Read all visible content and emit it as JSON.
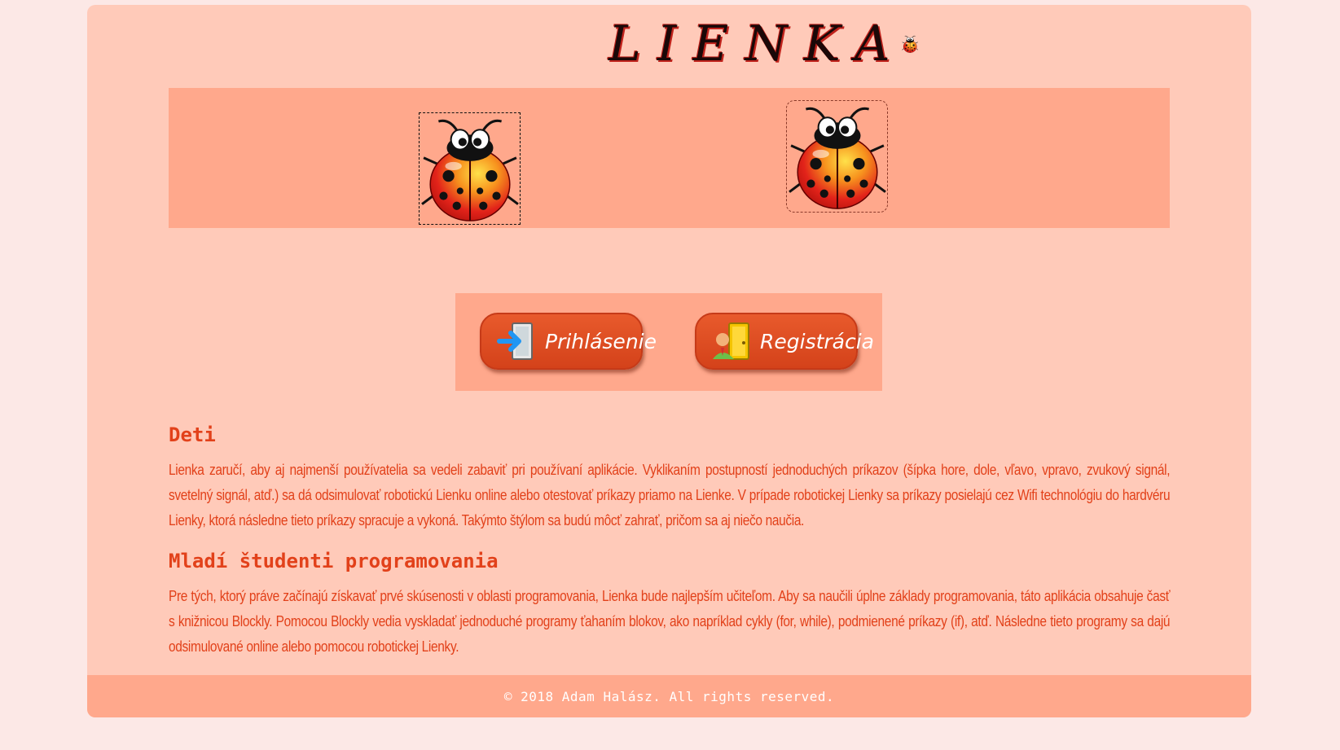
{
  "colors": {
    "page_bg": "#fce8e6",
    "card_bg": "#ffcab9",
    "accent_panel": "#ffa88c",
    "text_accent": "#e2411a",
    "button_bg": "#e04e22"
  },
  "header": {
    "logo_text": "LIENKA",
    "logo_icon": "ladybug-icon"
  },
  "banner": {
    "images": [
      {
        "icon": "ladybug-icon"
      },
      {
        "icon": "ladybug-icon"
      }
    ]
  },
  "buttons": {
    "login_label": "Prihlásenie",
    "login_icon": "door-enter-icon",
    "register_label": "Registrácia",
    "register_icon": "user-door-icon"
  },
  "sections": [
    {
      "heading": "Deti",
      "text": "Lienka zaručí, aby aj najmenší používatelia sa vedeli zabaviť pri používaní aplikácie. Vyklikaním postupností jednoduchých príkazov (šípka hore, dole, vľavo, vpravo, zvukový signál, svetelný signál, atď.) sa dá odsimulovať robotickú Lienku online alebo otestovať príkazy priamo na Lienke. V prípade robotickej Lienky sa príkazy posielajú cez Wifi technológiu do hardvéru Lienky, ktorá následne tieto príkazy spracuje a vykoná. Takýmto štýlom sa budú môcť zahrať, pričom sa aj niečo naučia."
    },
    {
      "heading": "Mladí študenti programovania",
      "text": "Pre tých, ktorý práve začínajú získavať prvé skúsenosti v oblasti programovania, Lienka bude najlepším učiteľom. Aby sa naučili úplne základy programovania, táto aplikácia obsahuje časť s knižnicou Blockly. Pomocou Blockly vedia vyskladať jednoduché programy ťahaním blokov, ako napríklad cykly (for, while), podmienené príkazy (if), atď. Následne tieto programy sa dajú odsimulované online alebo pomocou robotickej Lienky."
    }
  ],
  "footer": {
    "copyright": "© 2018 Adam Halász. All rights reserved."
  }
}
